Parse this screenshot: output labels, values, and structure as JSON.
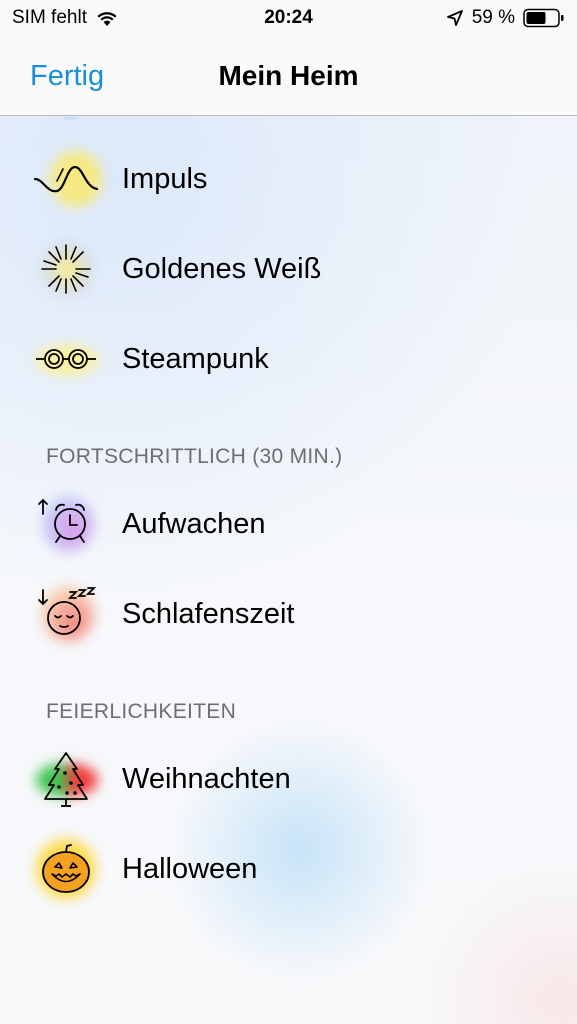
{
  "status_bar": {
    "carrier": "SIM fehlt",
    "time": "20:24",
    "battery": "59 %",
    "icons": [
      "wifi-icon",
      "location-icon",
      "battery-icon"
    ]
  },
  "nav": {
    "done_label": "Fertig",
    "title": "Mein Heim",
    "accent_color": "#1b8fd6"
  },
  "scenes": [
    {
      "label": "Impuls",
      "icon": "pulse-wave-icon"
    },
    {
      "label": "Goldenes Weiß",
      "icon": "sparkle-icon"
    },
    {
      "label": "Steampunk",
      "icon": "steampunk-goggles-icon"
    }
  ],
  "section_progressive": {
    "header": "FORTSCHRITTLICH (30 MIN.)",
    "items": [
      {
        "label": "Aufwachen",
        "icon": "alarm-clock-icon"
      },
      {
        "label": "Schlafenszeit",
        "icon": "sleeping-face-icon"
      }
    ]
  },
  "section_festive": {
    "header": "FEIERLICHKEITEN",
    "items": [
      {
        "label": "Weihnachten",
        "icon": "christmas-tree-icon"
      },
      {
        "label": "Halloween",
        "icon": "pumpkin-icon"
      }
    ]
  }
}
